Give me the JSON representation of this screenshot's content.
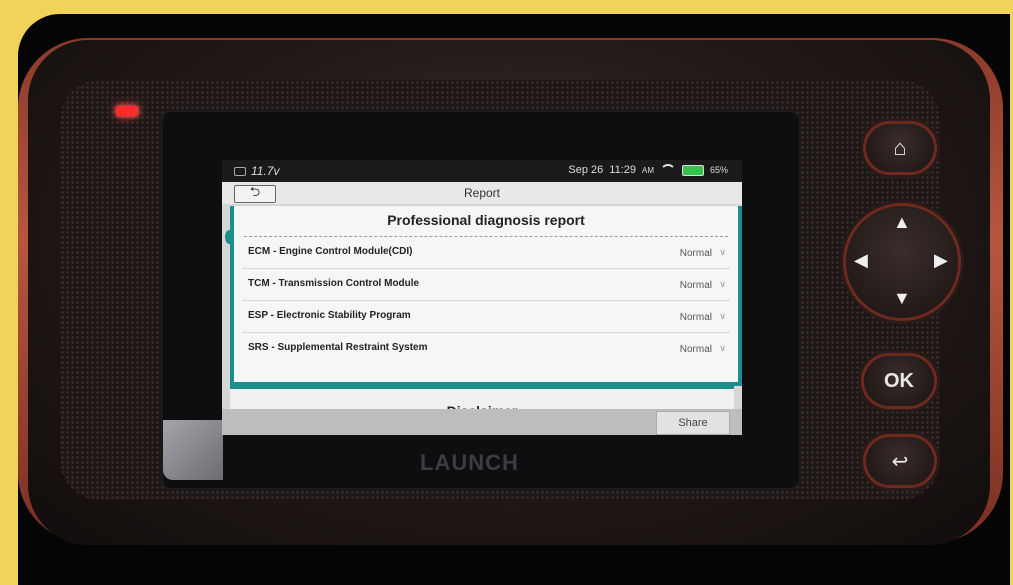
{
  "device": {
    "brand": "LAUNCH"
  },
  "status_bar": {
    "voltage": "11.7v",
    "date": "Sep 26",
    "time": "11:29",
    "ampm": "AM",
    "battery": "65%"
  },
  "header": {
    "title": "Report",
    "back_icon": "back-arrow-icon"
  },
  "report": {
    "title": "Professional diagnosis report",
    "rows": [
      {
        "label": "ECM - Engine Control Module(CDI)",
        "status": "Normal"
      },
      {
        "label": "TCM - Transmission Control Module",
        "status": "Normal"
      },
      {
        "label": "ESP - Electronic Stability Program",
        "status": "Normal"
      },
      {
        "label": "SRS - Supplemental Restraint System",
        "status": "Normal"
      }
    ]
  },
  "disclaimer": {
    "title": "Disclaimer"
  },
  "footer": {
    "share_label": "Share"
  },
  "hardware_buttons": {
    "ok_label": "OK"
  },
  "colors": {
    "accent": "#1b8f8c",
    "frame": "#f2d35a"
  }
}
